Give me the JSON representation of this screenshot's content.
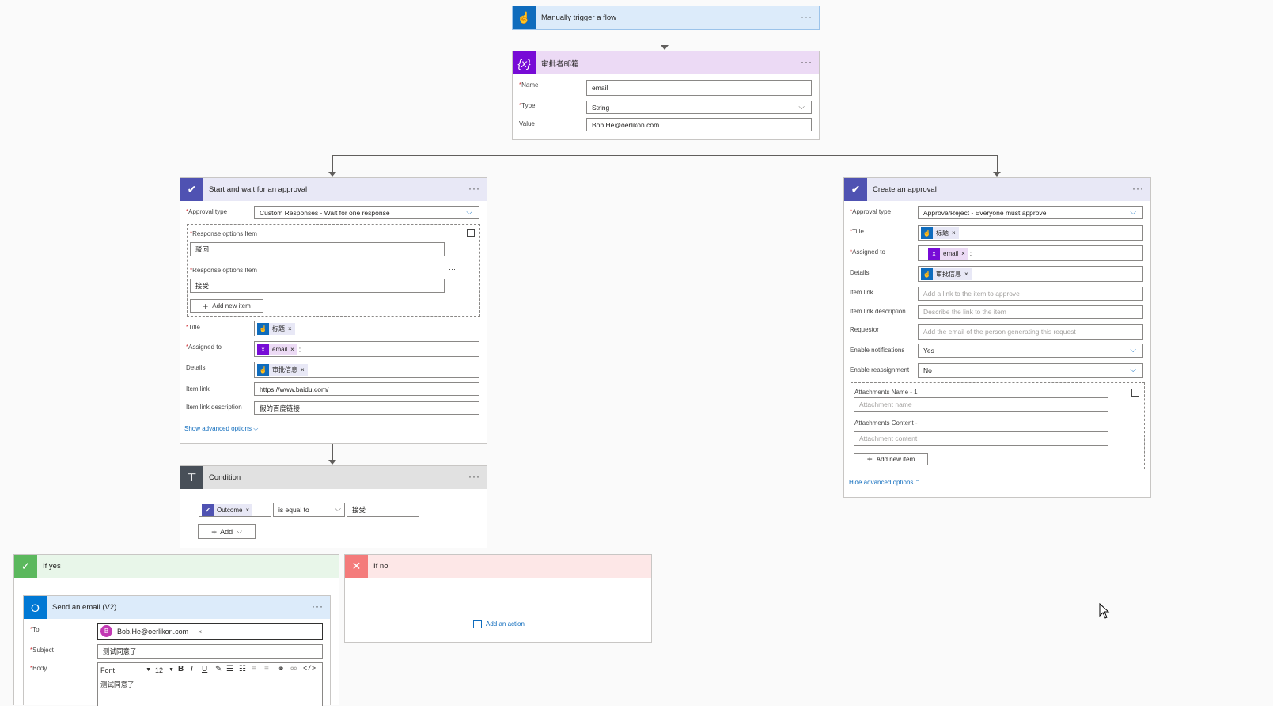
{
  "trigger": {
    "title": "Manually trigger a flow",
    "more": "···"
  },
  "variable": {
    "title": "审批者邮箱",
    "more": "···",
    "name_label": "Name",
    "name_value": "email",
    "type_label": "Type",
    "type_value": "String",
    "value_label": "Value",
    "value_value": "Bob.He@oerlikon.com"
  },
  "approval": {
    "title": "Start and wait for an approval",
    "more": "···",
    "type_label": "Approval type",
    "type_value": "Custom Responses - Wait for one response",
    "resp_label_1": "Response options Item",
    "resp_value_1": "驳回",
    "resp_label_2": "Response options Item",
    "resp_value_2": "接受",
    "resp_more": "···",
    "add_item": "Add new item",
    "title_label": "Title",
    "title_token": "标题",
    "assigned_label": "Assigned to",
    "assigned_token": "email",
    "assigned_sep": ";",
    "details_label": "Details",
    "details_token": "审批信息",
    "item_link_label": "Item link",
    "item_link_value": "https://www.baidu.com/",
    "item_link_desc_label": "Item link description",
    "item_link_desc_value": "假的百度链接",
    "show_advanced": "Show advanced options"
  },
  "condition": {
    "title": "Condition",
    "more": "···",
    "operand_token": "Outcome",
    "operator": "is equal to",
    "value": "接受",
    "add": "Add"
  },
  "create_approval": {
    "title": "Create an approval",
    "more": "···",
    "type_label": "Approval type",
    "type_value": "Approve/Reject - Everyone must approve",
    "title_label": "Title",
    "title_token": "标题",
    "assigned_label": "Assigned to",
    "assigned_token": "email",
    "assigned_sep": ";",
    "details_label": "Details",
    "details_token": "审批信息",
    "item_link_label": "Item link",
    "item_link_placeholder": "Add a link to the item to approve",
    "item_link_desc_label": "Item link description",
    "item_link_desc_placeholder": "Describe the link to the item",
    "requestor_label": "Requestor",
    "requestor_placeholder": "Add the email of the person generating this request",
    "notif_label": "Enable notifications",
    "notif_value": "Yes",
    "reassign_label": "Enable reassignment",
    "reassign_value": "No",
    "att_name_label": "Attachments Name - 1",
    "att_name_placeholder": "Attachment name",
    "att_content_label": "Attachments Content -",
    "att_content_placeholder": "Attachment content",
    "add_item": "Add new item",
    "hide_advanced": "Hide advanced options"
  },
  "if_yes": {
    "title": "If yes"
  },
  "if_no": {
    "title": "If no",
    "add_action": "Add an action"
  },
  "email": {
    "title": "Send an email (V2)",
    "more": "···",
    "to_label": "To",
    "to_avatar": "B",
    "to_value": "Bob.He@oerlikon.com",
    "subject_label": "Subject",
    "subject_value": "测试同意了",
    "body_label": "Body",
    "font": "Font",
    "size": "12",
    "body_text": "测试同意了"
  },
  "colors": {
    "trigger": "#0f6cbd",
    "variable": "#770bd6",
    "approval": "#4f52b2",
    "condition": "#484f58",
    "yes": "#5bb85d",
    "no": "#f47b7b",
    "outlook": "#0078d4"
  }
}
